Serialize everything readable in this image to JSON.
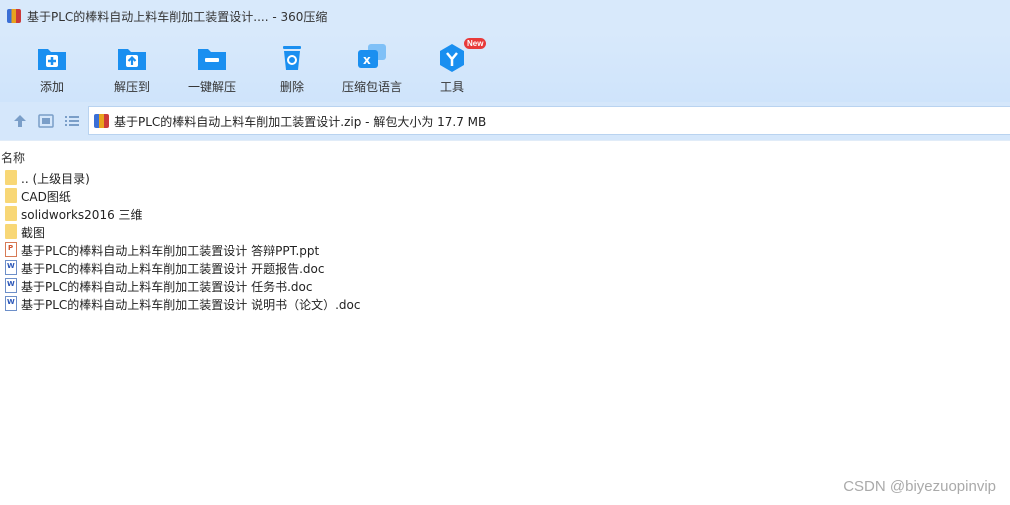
{
  "window": {
    "title": "基于PLC的棒料自动上料车削加工装置设计.... - 360压缩"
  },
  "toolbar": {
    "buttons": [
      {
        "label": "添加",
        "icon": "add-folder-icon"
      },
      {
        "label": "解压到",
        "icon": "extract-folder-icon"
      },
      {
        "label": "一键解压",
        "icon": "one-click-extract-icon"
      },
      {
        "label": "删除",
        "icon": "recycle-bin-icon"
      },
      {
        "label": "压缩包语言",
        "icon": "language-icon"
      },
      {
        "label": "工具",
        "icon": "tools-icon",
        "badge": "New"
      }
    ]
  },
  "address": {
    "text": "基于PLC的棒料自动上料车削加工装置设计.zip - 解包大小为 17.7 MB"
  },
  "list": {
    "column_name": "名称",
    "items": [
      {
        "name": ".. (上级目录)",
        "type": "folder"
      },
      {
        "name": "CAD图纸",
        "type": "folder"
      },
      {
        "name": "solidworks2016 三维",
        "type": "folder"
      },
      {
        "name": "截图",
        "type": "folder"
      },
      {
        "name": "基于PLC的棒料自动上料车削加工装置设计 答辩PPT.ppt",
        "type": "ppt"
      },
      {
        "name": "基于PLC的棒料自动上料车削加工装置设计 开题报告.doc",
        "type": "doc"
      },
      {
        "name": "基于PLC的棒料自动上料车削加工装置设计 任务书.doc",
        "type": "doc"
      },
      {
        "name": "基于PLC的棒料自动上料车削加工装置设计 说明书（论文）.doc",
        "type": "doc"
      }
    ]
  },
  "watermark": "CSDN @biyezuopinvip",
  "colors": {
    "accent": "#1a8ff0",
    "toolbar_bg": "#d8e9fb",
    "folder": "#f8d776"
  }
}
